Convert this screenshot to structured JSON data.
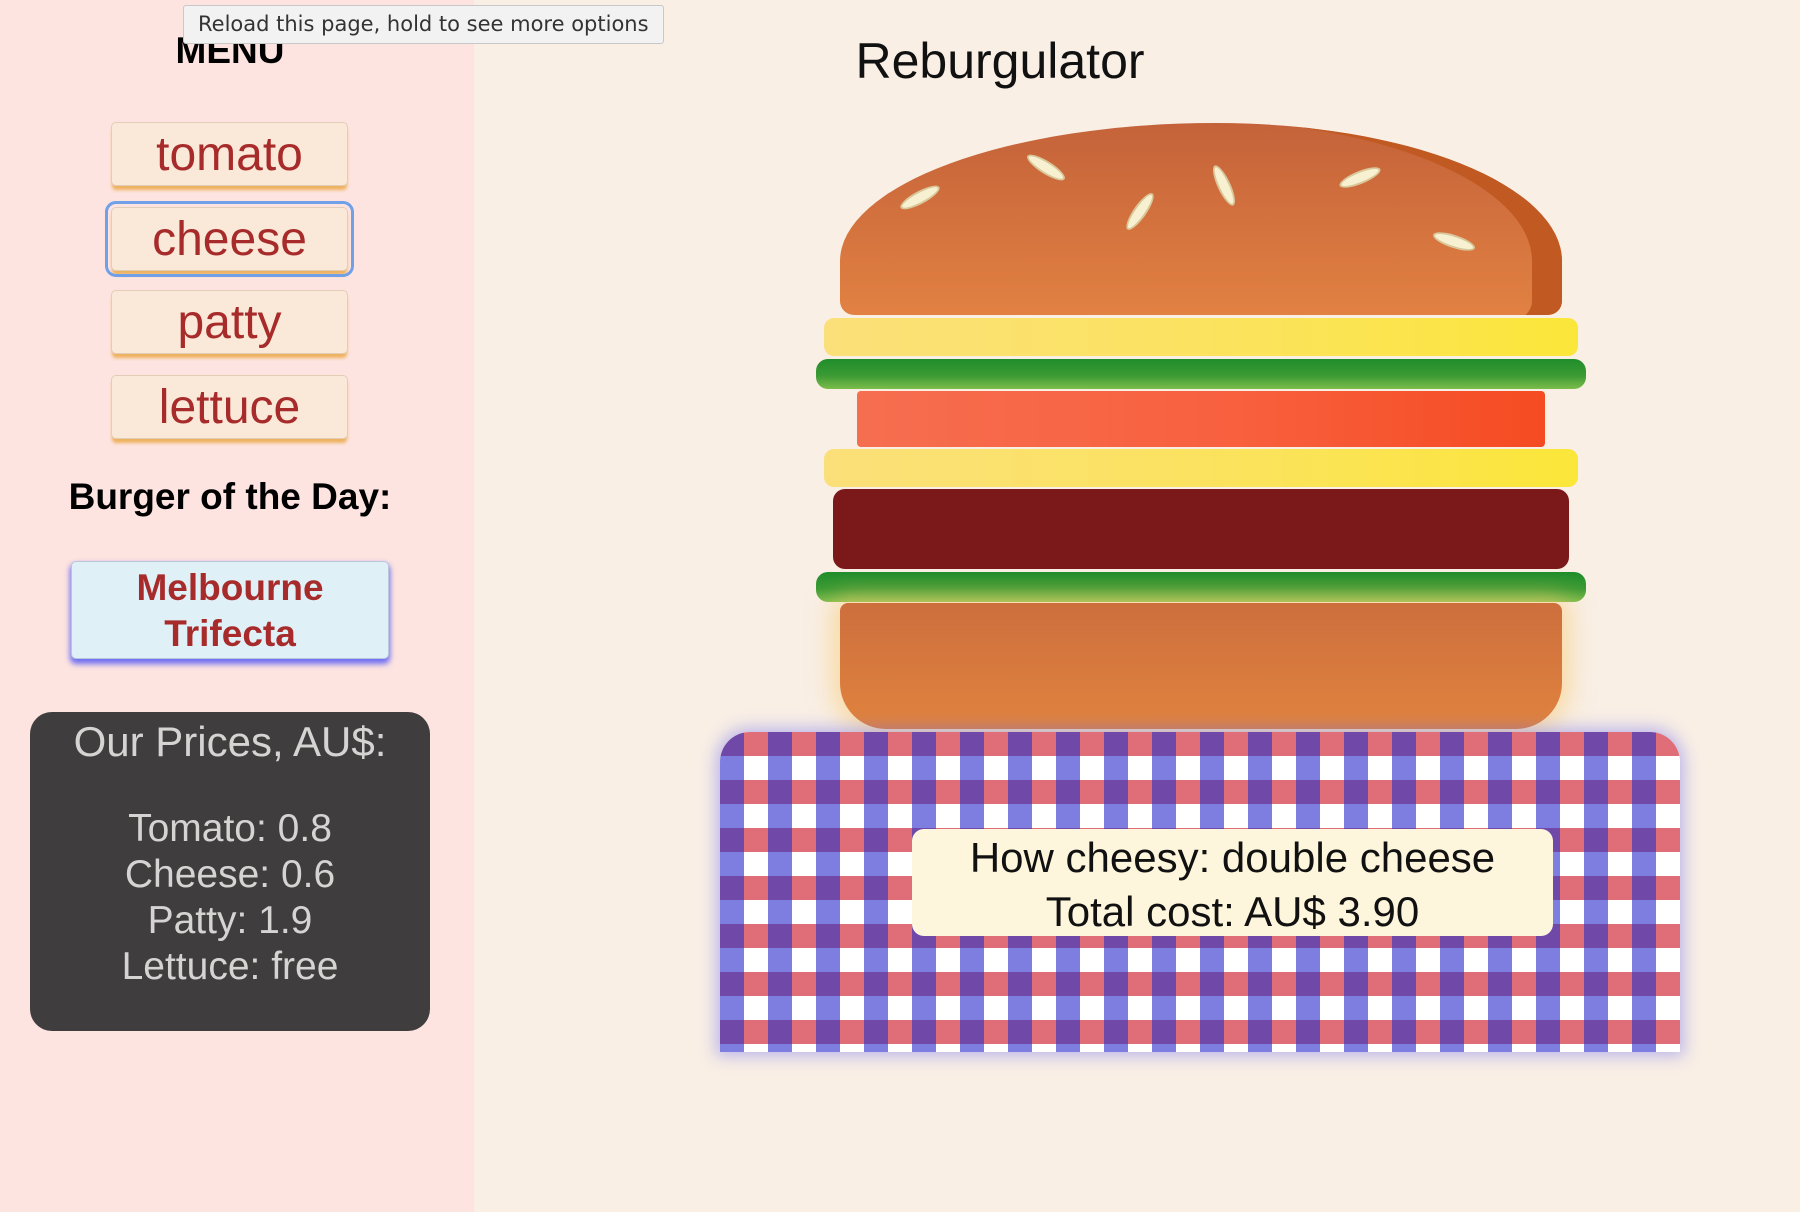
{
  "tooltip": "Reload this page, hold to see more options",
  "sidebar": {
    "menu_title": "MENU",
    "ingredients": [
      {
        "label": "tomato",
        "focused": false
      },
      {
        "label": "cheese",
        "focused": true
      },
      {
        "label": "patty",
        "focused": false
      },
      {
        "label": "lettuce",
        "focused": false
      }
    ],
    "burger_of_day_title": "Burger of the Day:",
    "burger_of_day_line1": "Melbourne",
    "burger_of_day_line2": "Trifecta",
    "prices": {
      "title": "Our Prices, AU$:",
      "items": [
        "Tomato: 0.8",
        "Cheese: 0.6",
        "Patty: 1.9",
        "Lettuce: free"
      ]
    }
  },
  "main": {
    "title": "Reburgulator",
    "burger_layers_top_to_bottom": [
      "bun-top",
      "cheese",
      "lettuce",
      "tomato",
      "cheese",
      "patty",
      "lettuce",
      "bun-bottom"
    ],
    "summary": {
      "cheese_line": "How cheesy: double cheese",
      "cost_line": "Total cost: AU$ 3.90"
    }
  },
  "colors": {
    "sidebar_bg": "#fde4e0",
    "main_bg": "#f9efe5",
    "button_text": "#a82b2b",
    "prices_bg": "#403d3e",
    "cloth_red": "#e06e78",
    "cloth_blue": "#7d7ee0",
    "cloth_purple": "#6f48a8"
  }
}
